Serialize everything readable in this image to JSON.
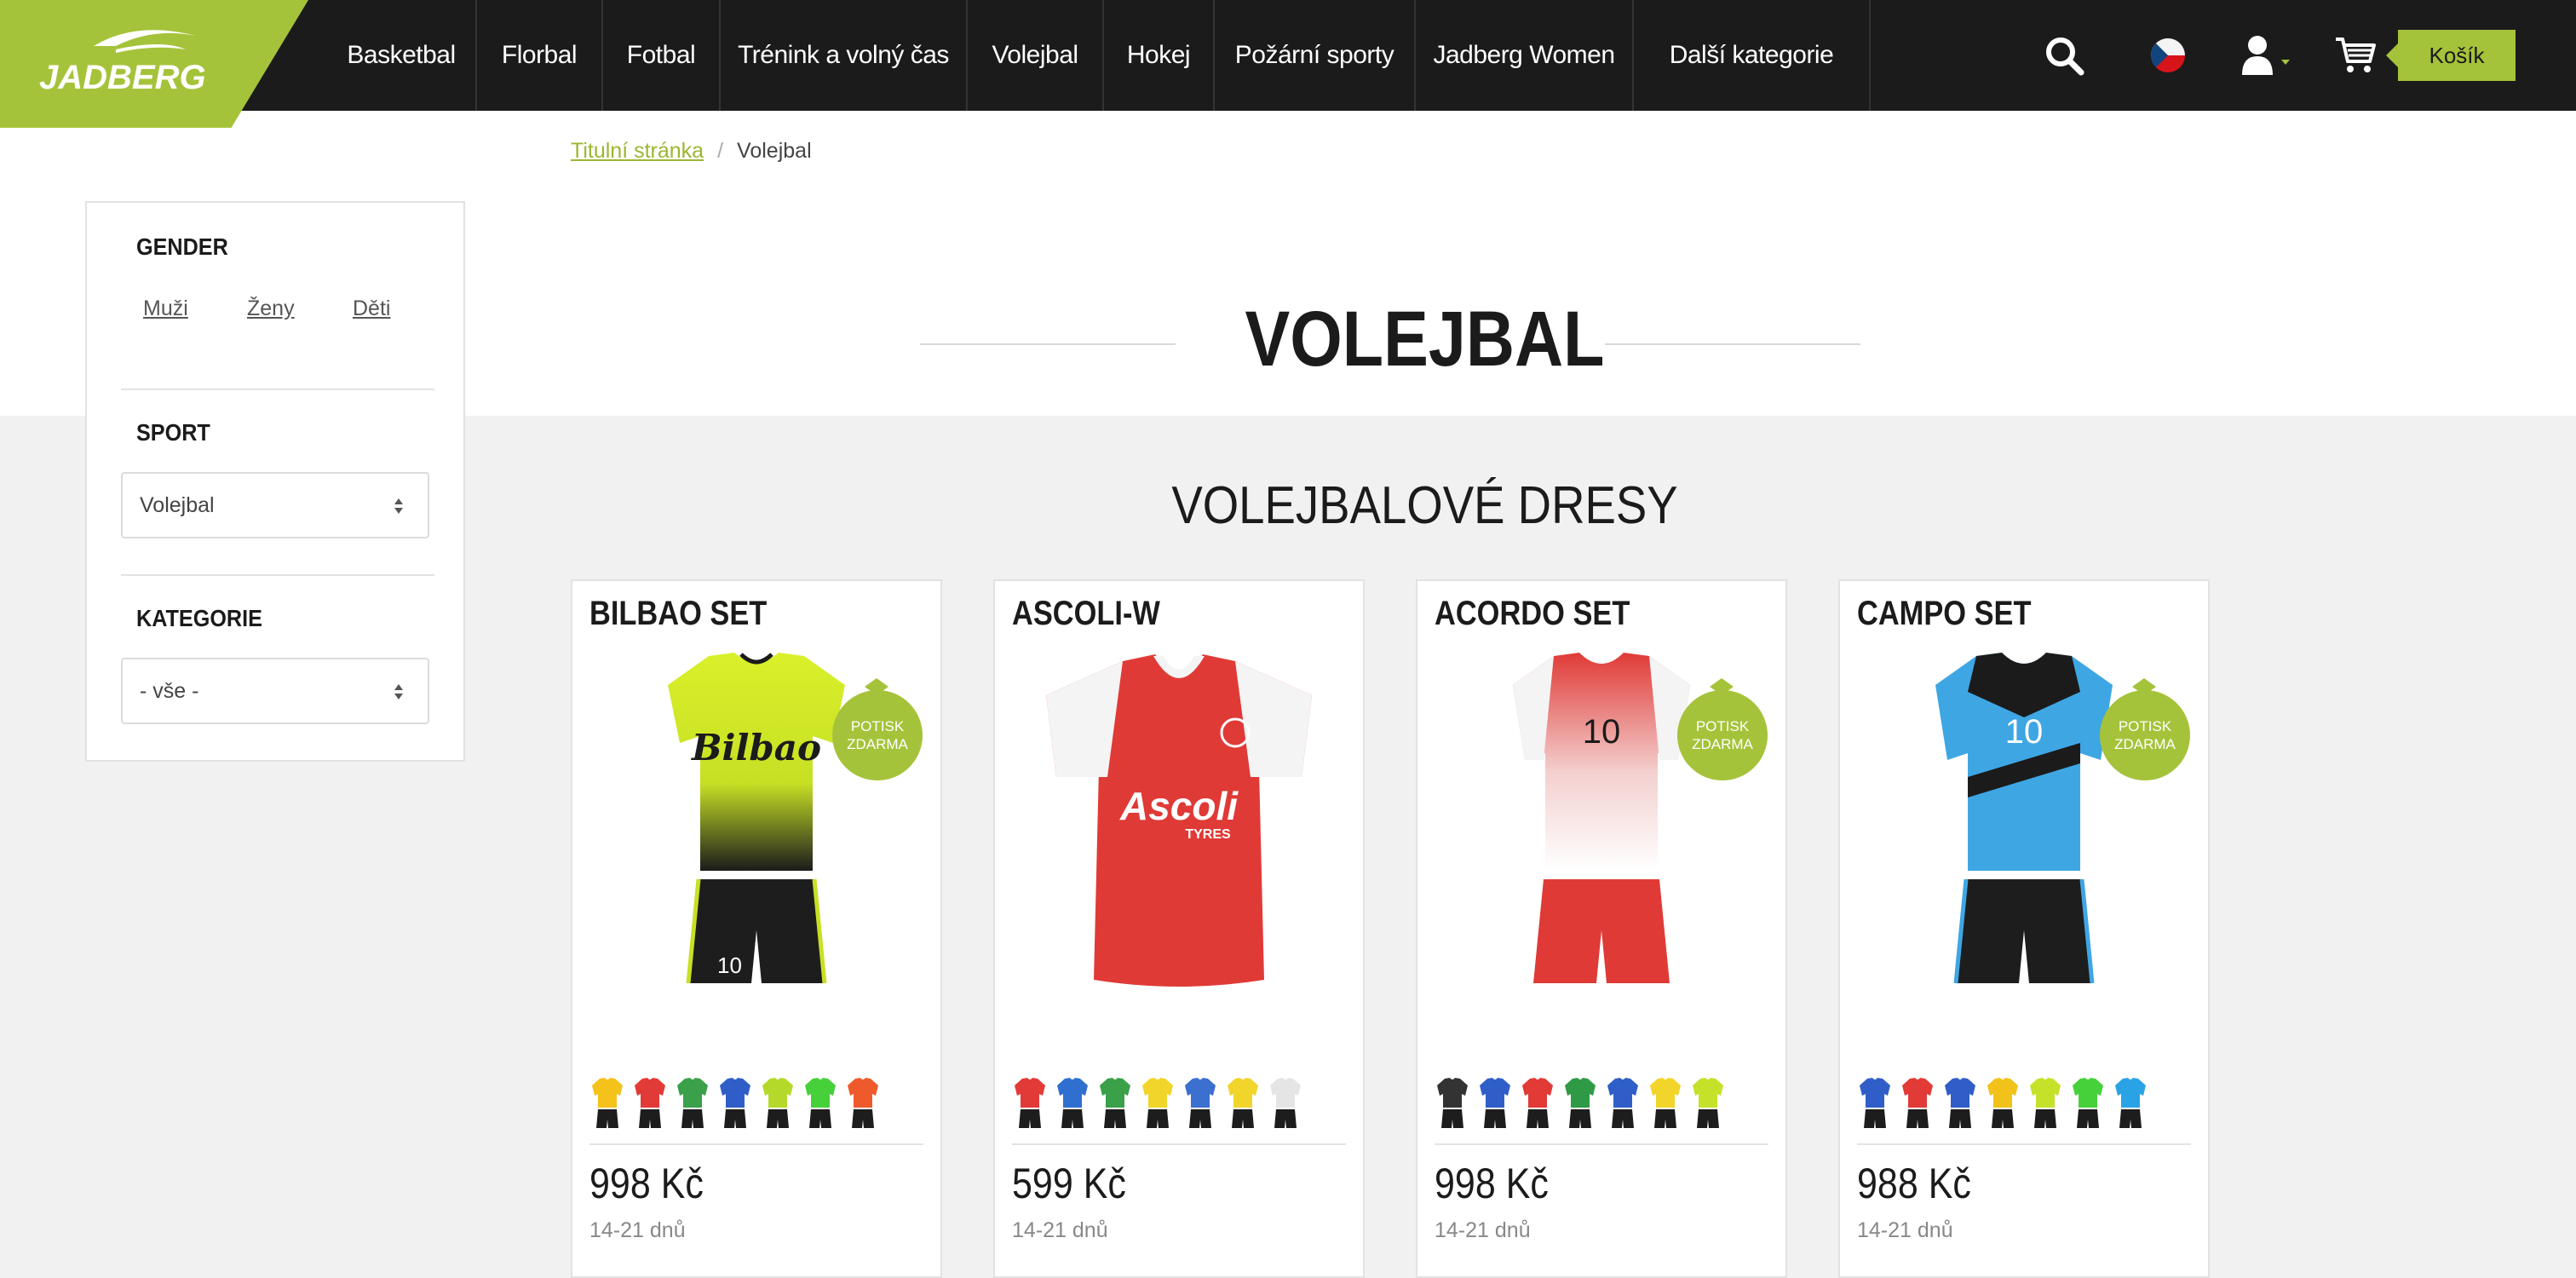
{
  "brand": {
    "name": "JADBERG",
    "accent": "#a5c33a",
    "dark": "#1b1b1b"
  },
  "nav": {
    "items": [
      "Basketbal",
      "Florbal",
      "Fotbal",
      "Trénink a volný čas",
      "Volejbal",
      "Hokej",
      "Požární sporty",
      "Jadberg Women",
      "Další kategorie"
    ]
  },
  "header": {
    "search_icon": "search-icon",
    "language_icon": "czech-flag-icon",
    "user_icon": "user-icon",
    "cart_icon": "cart-icon",
    "cart_label": "Košík"
  },
  "breadcrumb": {
    "home": "Titulní stránka",
    "separator": "/",
    "current": "Volejbal"
  },
  "page_title": "VOLEJBAL",
  "sidebar": {
    "gender": {
      "title": "GENDER",
      "options": [
        "Muži",
        "Ženy",
        "Děti"
      ]
    },
    "sport": {
      "title": "SPORT",
      "selected": "Volejbal"
    },
    "category": {
      "title": "KATEGORIE",
      "selected": "- vše -"
    }
  },
  "section_title": "VOLEJBALOVÉ DRESY",
  "products": [
    {
      "name": "BILBAO SET",
      "price": "998 Kč",
      "delivery": "14-21 dnů",
      "badge": [
        "POTISK",
        "ZDARMA"
      ],
      "print_text": "Bilbao",
      "colors": [
        "#f4c21a",
        "#e23a36",
        "#3aa04a",
        "#2f5ec8",
        "#b5d92a",
        "#46d13a",
        "#ef5a2c"
      ]
    },
    {
      "name": "ASCOLI-W",
      "price": "599 Kč",
      "delivery": "14-21 dnů",
      "badge": [],
      "print_text": "Ascoli",
      "colors": [
        "#e23a36",
        "#2f6fd0",
        "#3aa04a",
        "#f1d52a",
        "#3b6fd0",
        "#f1d52a",
        "#e5e5e5"
      ]
    },
    {
      "name": "ACORDO SET",
      "price": "998 Kč",
      "delivery": "14-21 dnů",
      "badge": [
        "POTISK",
        "ZDARMA"
      ],
      "print_text": "10",
      "colors": [
        "#333333",
        "#2f5ec8",
        "#e23a36",
        "#2f9a45",
        "#2f5ec8",
        "#f1d52a",
        "#c6e12a"
      ]
    },
    {
      "name": "CAMPO SET",
      "price": "988 Kč",
      "delivery": "14-21 dnů",
      "badge": [
        "POTISK",
        "ZDARMA"
      ],
      "print_text": "10",
      "colors": [
        "#2f5ec8",
        "#e23a36",
        "#2f5ec8",
        "#f1c21a",
        "#c6e12a",
        "#46d13a",
        "#2aa3e6"
      ]
    }
  ]
}
